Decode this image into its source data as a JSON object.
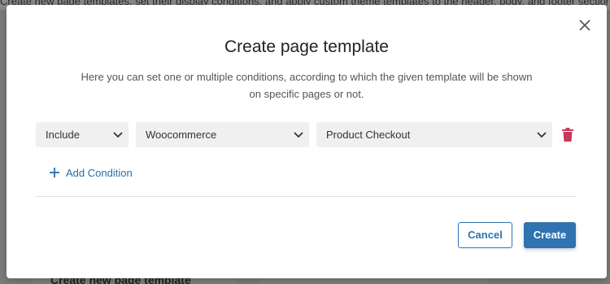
{
  "background": {
    "top_text": "Create new page templates, set their display conditions, and apply custom theme templates to the header, body, and footer sections.",
    "bottom_text": "Create new page template"
  },
  "modal": {
    "title": "Create page template",
    "description": "Here you can set one or multiple conditions, according to which the given template will be shown on specific pages or not.",
    "condition": {
      "type": "Include",
      "category": "Woocommerce",
      "page": "Product Checkout"
    },
    "add_condition_label": "Add Condition",
    "cancel_label": "Cancel",
    "create_label": "Create"
  },
  "colors": {
    "accent": "#2f73b0",
    "delete": "#c8385a"
  },
  "icons": {
    "close": "close-icon",
    "chevron": "chevron-down-icon",
    "delete": "trash-icon",
    "add": "plus-icon"
  }
}
